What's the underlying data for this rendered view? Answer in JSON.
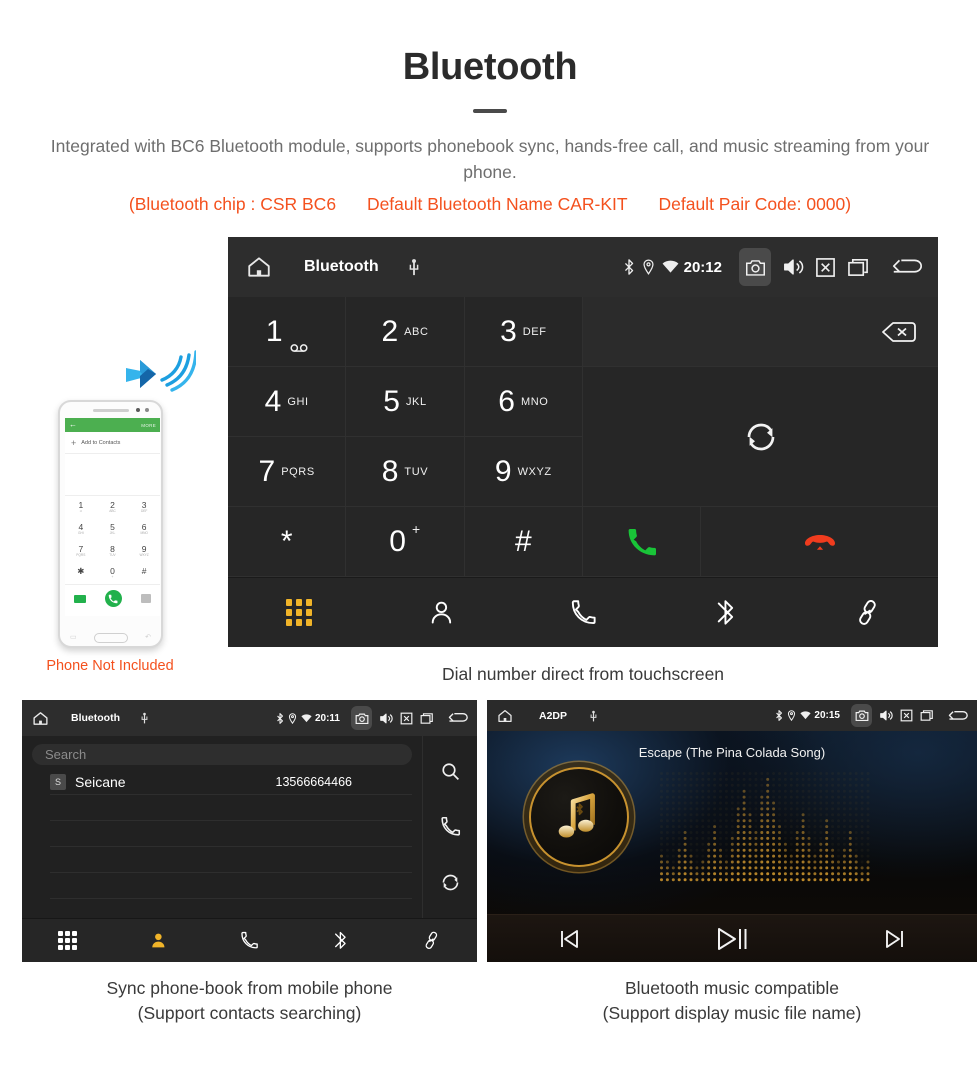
{
  "header": {
    "title": "Bluetooth",
    "subtitle": "Integrated with BC6 Bluetooth module, supports phonebook sync, hands-free call, and music streaming from your phone.",
    "specs": [
      "(Bluetooth chip : CSR BC6",
      "Default Bluetooth Name CAR-KIT",
      "Default Pair Code: 0000)"
    ],
    "spec_color": "#f4511e"
  },
  "dialer": {
    "statusbar": {
      "title": "Bluetooth",
      "clock": "20:12",
      "icons": [
        "home-icon",
        "usb-icon",
        "bluetooth-icon",
        "location-icon",
        "wifi-icon",
        "camera-icon",
        "volume-icon",
        "mute-icon",
        "recents-icon",
        "back-icon"
      ]
    },
    "keys": [
      {
        "digit": "1",
        "sub": "∞",
        "sub_kind": "voicemail"
      },
      {
        "digit": "2",
        "sub": "ABC",
        "sub_kind": "letters"
      },
      {
        "digit": "3",
        "sub": "DEF",
        "sub_kind": "letters"
      },
      {
        "digit": "4",
        "sub": "GHI",
        "sub_kind": "letters"
      },
      {
        "digit": "5",
        "sub": "JKL",
        "sub_kind": "letters"
      },
      {
        "digit": "6",
        "sub": "MNO",
        "sub_kind": "letters"
      },
      {
        "digit": "7",
        "sub": "PQRS",
        "sub_kind": "letters"
      },
      {
        "digit": "8",
        "sub": "TUV",
        "sub_kind": "letters"
      },
      {
        "digit": "9",
        "sub": "WXYZ",
        "sub_kind": "letters"
      },
      {
        "digit": "*",
        "sub": "",
        "sub_kind": "none"
      },
      {
        "digit": "0",
        "sub": "+",
        "sub_kind": "plus"
      },
      {
        "digit": "#",
        "sub": "",
        "sub_kind": "none"
      }
    ],
    "number_display": "",
    "actions": {
      "backspace": "backspace-icon",
      "transfer": "transfer-audio-icon",
      "call": "call-button",
      "call_color": "#19c438",
      "hangup": "hangup-button",
      "hangup_color": "#f03c1e"
    },
    "nav": [
      {
        "name": "dialpad",
        "active": true
      },
      {
        "name": "contacts",
        "active": false
      },
      {
        "name": "call-log",
        "active": false
      },
      {
        "name": "bluetooth",
        "active": false
      },
      {
        "name": "link",
        "active": false
      }
    ],
    "active_color": "#f0b429",
    "caption": "Dial number direct from touchscreen"
  },
  "phone_mock": {
    "topbar_back": "←",
    "topbar_more": "MORE",
    "add_contacts": "Add to Contacts",
    "keys": [
      {
        "d": "1",
        "s": "∞"
      },
      {
        "d": "2",
        "s": "ABC"
      },
      {
        "d": "3",
        "s": "DEF"
      },
      {
        "d": "4",
        "s": "GHI"
      },
      {
        "d": "5",
        "s": "JKL"
      },
      {
        "d": "6",
        "s": "MNO"
      },
      {
        "d": "7",
        "s": "PQRS"
      },
      {
        "d": "8",
        "s": "TUV"
      },
      {
        "d": "9",
        "s": "WXYZ"
      },
      {
        "d": "✱",
        "s": ""
      },
      {
        "d": "0",
        "s": "+"
      },
      {
        "d": "#",
        "s": ""
      }
    ],
    "soft_left": "▭",
    "soft_right": "↶",
    "note": "Phone Not Included",
    "note_color": "#f4511e",
    "bt_wave_color": "#1d9fe0"
  },
  "phonebook": {
    "statusbar": {
      "title": "Bluetooth",
      "clock": "20:11"
    },
    "search_placeholder": "Search",
    "contacts": [
      {
        "badge": "S",
        "name": "Seicane",
        "number": "13566664466"
      }
    ],
    "empty_rows": 4,
    "side_actions": [
      "search-icon",
      "call-icon",
      "sync-icon"
    ],
    "nav": [
      {
        "name": "dialpad",
        "active": false
      },
      {
        "name": "contacts",
        "active": true
      },
      {
        "name": "call-log",
        "active": false
      },
      {
        "name": "bluetooth",
        "active": false
      },
      {
        "name": "link",
        "active": false
      }
    ],
    "caption_line1": "Sync phone-book from mobile phone",
    "caption_line2": "(Support contacts searching)"
  },
  "music": {
    "statusbar": {
      "title": "A2DP",
      "clock": "20:15"
    },
    "track_name": "Escape (The Pina Colada Song)",
    "album_icon": "music-note-bluetooth-icon",
    "accent_color": "#c8922e",
    "controls": [
      {
        "name": "previous-track",
        "glyph": "prev"
      },
      {
        "name": "play-pause",
        "glyph": "playpause"
      },
      {
        "name": "next-track",
        "glyph": "next"
      }
    ],
    "caption_line1": "Bluetooth music compatible",
    "caption_line2": "(Support display music file name)"
  }
}
